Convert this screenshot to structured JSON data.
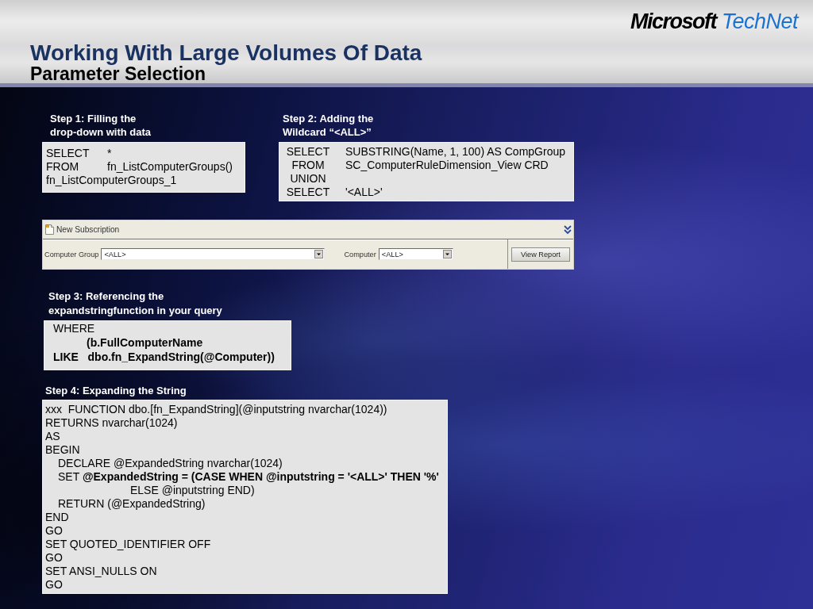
{
  "header": {
    "logo": "**Microsoft** TechNet",
    "title": "Working With Large Volumes Of Data",
    "subtitle": "Parameter Selection"
  },
  "steps": [
    {
      "kind": "columns",
      "heading": [
        "Step 1: Filling the",
        "drop-down with data"
      ],
      "lines": [
        {
          "keyword": "SELECT",
          "expr": "*"
        },
        {
          "keyword": "FROM",
          "expr": "fn_ListComputerGroups()"
        },
        {
          "expr": "fn_ListComputerGroups_1"
        }
      ]
    },
    {
      "kind": "columns",
      "heading": [
        "Step 2: Adding the",
        "Wildcard “<ALL>”"
      ],
      "lines": [
        {
          "keyword": "SELECT",
          "expr": "SUBSTRING(Name, 1, 100) AS CompGroup"
        },
        {
          "keyword": "FROM",
          "expr": "SC_ComputerRuleDimension_View CRD"
        },
        {
          "keyword": "UNION"
        },
        {
          "keyword": "SELECT",
          "expr": "'<ALL>'"
        }
      ]
    },
    {
      "kind": "lines",
      "heading": [
        "Step 3: Referencing the",
        "expandstringfunction in your query"
      ],
      "lines": [
        {
          "text": "WHERE",
          "bold": false,
          "children": [
            {
              "text": "(b.FullComputerName",
              "bold": true
            }
          ]
        },
        {
          "text": "LIKE   dbo.fn_ExpandString(@Computer))",
          "bold": true
        }
      ]
    },
    {
      "kind": "lines",
      "heading": [
        "Step 4: Expanding the String"
      ],
      "lines": [
        {
          "text": "xxx  FUNCTION dbo.[fn_ExpandString](@inputstring nvarchar(1024))"
        },
        {
          "text": "RETURNS nvarchar(1024)"
        },
        {
          "text": "AS"
        },
        {
          "text": "BEGIN",
          "children": [
            {
              "text": "DECLARE @ExpandedString nvarchar(1024)"
            },
            {
              "text": "SET **@ExpandedString = (CASE WHEN @inputstring = '<ALL>' THEN '%'**",
              "children": [
                {
                  "text": "ELSE @inputstring END)"
                }
              ]
            },
            {
              "text": "RETURN (@ExpandedString)"
            }
          ]
        },
        {
          "text": "END"
        },
        {
          "text": "GO"
        },
        {
          "text": "SET QUOTED_IDENTIFIER OFF"
        },
        {
          "text": "GO"
        },
        {
          "text": "SET ANSI_NULLS ON"
        },
        {
          "text": "GO"
        }
      ]
    }
  ],
  "subscription": {
    "title": "New Subscription",
    "fields": [
      {
        "label": "Computer Group",
        "value": "<ALL>"
      },
      {
        "label": "Computer",
        "value": "<ALL>"
      }
    ],
    "button": "View Report"
  }
}
